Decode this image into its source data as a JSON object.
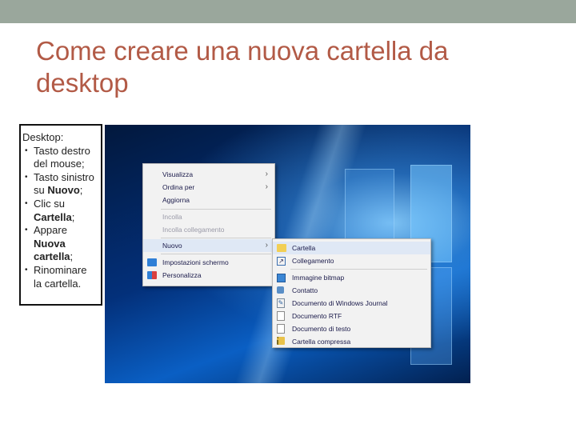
{
  "slide": {
    "title": "Come creare una nuova cartella da desktop"
  },
  "instructions": {
    "heading": "Desktop:",
    "steps": [
      {
        "text": "Tasto destro del mouse;"
      },
      {
        "pre": "Tasto sinistro su ",
        "bold": "Nuovo",
        "post": ";"
      },
      {
        "pre": "Clic su ",
        "bold": "Cartella",
        "post": ";"
      },
      {
        "pre": "Appare ",
        "bold": "Nuova cartella",
        "post": ";"
      },
      {
        "text": "Rinominare la cartella."
      }
    ]
  },
  "context_menu": {
    "items": [
      {
        "label": "Visualizza",
        "submenu": true
      },
      {
        "label": "Ordina per",
        "submenu": true
      },
      {
        "label": "Aggiorna"
      },
      {
        "label": "Incolla",
        "disabled": true
      },
      {
        "label": "Incolla collegamento",
        "disabled": true
      },
      {
        "label": "Nuovo",
        "submenu": true
      },
      {
        "label": "Impostazioni schermo",
        "icon": "display-settings-icon"
      },
      {
        "label": "Personalizza",
        "icon": "personalize-icon"
      }
    ]
  },
  "new_submenu": {
    "items": [
      {
        "label": "Cartella",
        "icon": "folder-icon"
      },
      {
        "label": "Collegamento",
        "icon": "shortcut-icon"
      },
      {
        "label": "Immagine bitmap",
        "icon": "bitmap-icon"
      },
      {
        "label": "Contatto",
        "icon": "contact-icon"
      },
      {
        "label": "Documento di Windows Journal",
        "icon": "journal-icon"
      },
      {
        "label": "Documento RTF",
        "icon": "rtf-document-icon"
      },
      {
        "label": "Documento di testo",
        "icon": "text-document-icon"
      },
      {
        "label": "Cartella compressa",
        "icon": "zip-folder-icon"
      }
    ]
  },
  "colors": {
    "title": "#b25a46",
    "top_bar": "#9aa79c",
    "menu_bg": "#f2f2f2",
    "highlight": "#dfe8f5"
  }
}
